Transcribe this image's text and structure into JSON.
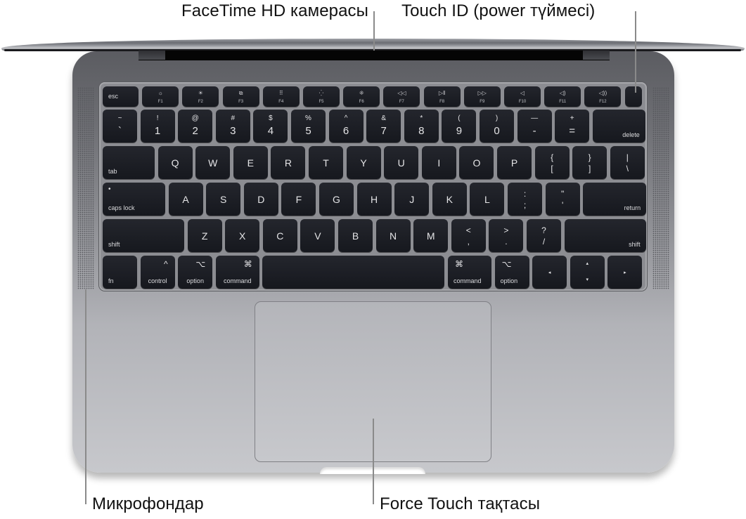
{
  "callouts": {
    "camera": "FaceTime HD камерасы",
    "touch_id": "Touch ID (power түймесі)",
    "microphones": "Микрофондар",
    "trackpad": "Force Touch тақтасы"
  },
  "colors": {
    "key_face": "#1b1d23",
    "key_text": "#e4e4e6",
    "body_top": "#5b5c61",
    "body_bottom": "#c7c8cc",
    "leader_line": "#8a8a8a"
  },
  "keyboard": {
    "function_row": [
      {
        "id": "esc",
        "label": "esc"
      },
      {
        "id": "f1",
        "icon": "☼",
        "label": "F1"
      },
      {
        "id": "f2",
        "icon": "☀",
        "label": "F2"
      },
      {
        "id": "f3",
        "icon": "⧉",
        "label": "F3"
      },
      {
        "id": "f4",
        "icon": "⠿",
        "label": "F4"
      },
      {
        "id": "f5",
        "icon": "⁛",
        "label": "F5"
      },
      {
        "id": "f6",
        "icon": "⁜",
        "label": "F6"
      },
      {
        "id": "f7",
        "icon": "◁◁",
        "label": "F7"
      },
      {
        "id": "f8",
        "icon": "▷ǁ",
        "label": "F8"
      },
      {
        "id": "f9",
        "icon": "▷▷",
        "label": "F9"
      },
      {
        "id": "f10",
        "icon": "◁",
        "label": "F10"
      },
      {
        "id": "f11",
        "icon": "◁)",
        "label": "F11"
      },
      {
        "id": "f12",
        "icon": "◁))",
        "label": "F12"
      },
      {
        "id": "touch-id",
        "label": ""
      }
    ],
    "number_row": [
      {
        "top": "~",
        "bottom": "`"
      },
      {
        "top": "!",
        "bottom": "1"
      },
      {
        "top": "@",
        "bottom": "2"
      },
      {
        "top": "#",
        "bottom": "3"
      },
      {
        "top": "$",
        "bottom": "4"
      },
      {
        "top": "%",
        "bottom": "5"
      },
      {
        "top": "^",
        "bottom": "6"
      },
      {
        "top": "&",
        "bottom": "7"
      },
      {
        "top": "*",
        "bottom": "8"
      },
      {
        "top": "(",
        "bottom": "9"
      },
      {
        "top": ")",
        "bottom": "0"
      },
      {
        "top": "—",
        "bottom": "-"
      },
      {
        "top": "+",
        "bottom": "="
      },
      {
        "label": "delete"
      }
    ],
    "qwerty_row": [
      {
        "label": "tab"
      },
      {
        "main": "Q"
      },
      {
        "main": "W"
      },
      {
        "main": "E"
      },
      {
        "main": "R"
      },
      {
        "main": "T"
      },
      {
        "main": "Y"
      },
      {
        "main": "U"
      },
      {
        "main": "I"
      },
      {
        "main": "O"
      },
      {
        "main": "P"
      },
      {
        "top": "{",
        "bottom": "["
      },
      {
        "top": "}",
        "bottom": "]"
      },
      {
        "top": "|",
        "bottom": "\\"
      }
    ],
    "home_row": [
      {
        "label": "caps lock",
        "indicator": "•"
      },
      {
        "main": "A"
      },
      {
        "main": "S"
      },
      {
        "main": "D"
      },
      {
        "main": "F"
      },
      {
        "main": "G"
      },
      {
        "main": "H"
      },
      {
        "main": "J"
      },
      {
        "main": "K"
      },
      {
        "main": "L"
      },
      {
        "top": ":",
        "bottom": ";"
      },
      {
        "top": "\"",
        "bottom": "'"
      },
      {
        "label": "return"
      }
    ],
    "shift_row": [
      {
        "label": "shift"
      },
      {
        "main": "Z"
      },
      {
        "main": "X"
      },
      {
        "main": "C"
      },
      {
        "main": "V"
      },
      {
        "main": "B"
      },
      {
        "main": "N"
      },
      {
        "main": "M"
      },
      {
        "top": "<",
        "bottom": ","
      },
      {
        "top": ">",
        "bottom": "."
      },
      {
        "top": "?",
        "bottom": "/"
      },
      {
        "label": "shift"
      }
    ],
    "bottom_row": [
      {
        "label": "fn"
      },
      {
        "label": "control",
        "symbol": "^"
      },
      {
        "label": "option",
        "symbol": "⌥"
      },
      {
        "label": "command",
        "symbol": "⌘"
      },
      {
        "label": ""
      },
      {
        "label": "command",
        "symbol": "⌘"
      },
      {
        "label": "option",
        "symbol": "⌥"
      },
      {
        "arrow": "◂"
      },
      {
        "arrow_up": "▴",
        "arrow_down": "▾"
      },
      {
        "arrow": "▸"
      }
    ]
  }
}
